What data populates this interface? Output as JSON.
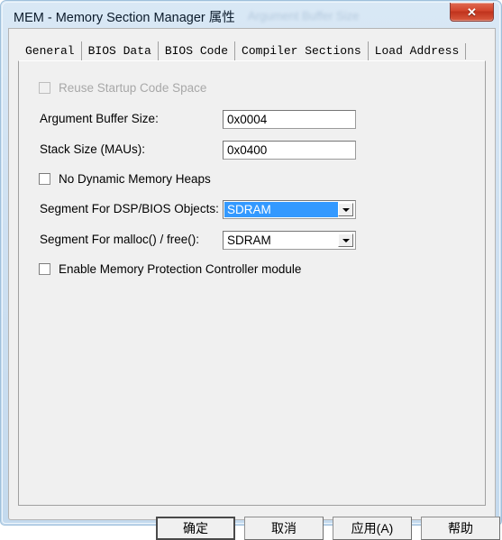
{
  "window": {
    "title": "MEM - Memory Section Manager 属性",
    "ghost_text": "Argument Buffer Size",
    "close_glyph": "✕",
    "accent_titlebar": "#cfe1f2",
    "close_button_color": "#c0331d"
  },
  "tabs": [
    {
      "label": "General",
      "selected": true
    },
    {
      "label": "BIOS Data",
      "selected": false
    },
    {
      "label": "BIOS Code",
      "selected": false
    },
    {
      "label": "Compiler Sections",
      "selected": false
    },
    {
      "label": "Load Address",
      "selected": false
    }
  ],
  "general_tab": {
    "reuse_startup": {
      "label": "Reuse Startup Code Space",
      "checked": false,
      "disabled": true
    },
    "argument_buffer_size": {
      "label": "Argument Buffer Size:",
      "value": "0x0004"
    },
    "stack_size": {
      "label": "Stack Size (MAUs):",
      "value": "0x0400"
    },
    "no_dynamic_heaps": {
      "label": "No Dynamic Memory Heaps",
      "checked": false
    },
    "segment_dsp_bios": {
      "label": "Segment For DSP/BIOS Objects:",
      "value": "SDRAM",
      "highlighted": true,
      "highlight_color": "#3399ff"
    },
    "segment_malloc_free": {
      "label": "Segment For malloc() / free():",
      "value": "SDRAM",
      "highlighted": false
    },
    "enable_mpc": {
      "label": "Enable Memory Protection Controller module",
      "checked": false
    }
  },
  "buttons": {
    "ok": "确定",
    "cancel": "取消",
    "apply": "应用(A)",
    "help": "帮助"
  }
}
